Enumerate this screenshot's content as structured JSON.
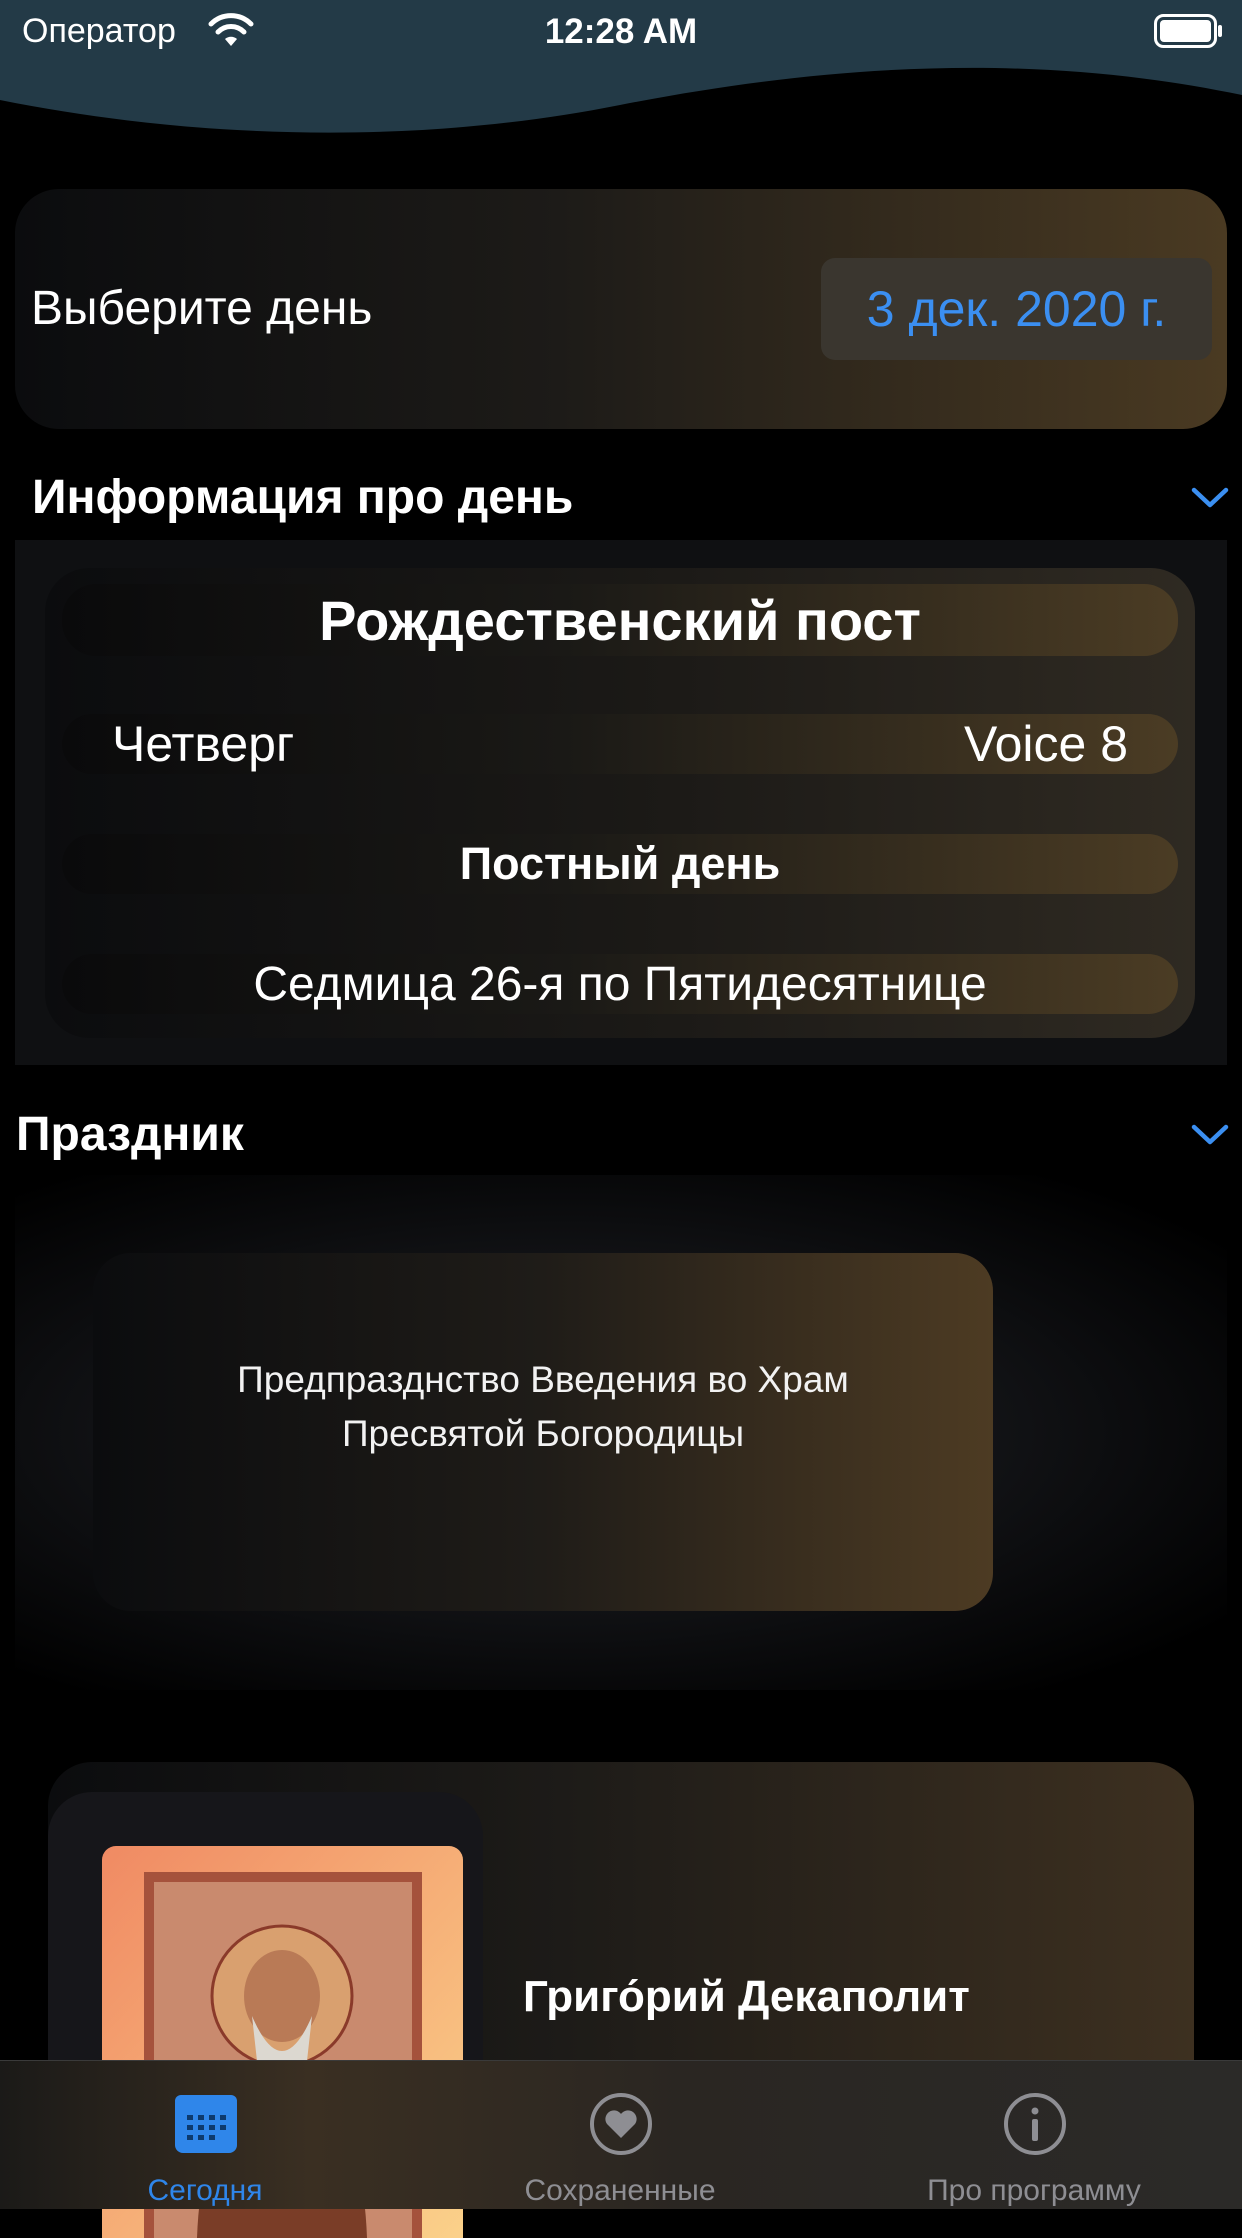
{
  "status_bar": {
    "carrier": "Оператор",
    "time": "12:28 AM"
  },
  "date_picker": {
    "label": "Выберите день",
    "value": "3 дек. 2020 г."
  },
  "day_info": {
    "title": "Информация про день",
    "fast_name": "Рождественский пост",
    "weekday": "Четверг",
    "voice": "Voice 8",
    "fasting": "Постный день",
    "week": "Седмица 26-я по Пятидесятнице"
  },
  "feast": {
    "title": "Праздник",
    "name": "Предпразднство Введения во Храм\nПресвятой Богородицы"
  },
  "saint": {
    "name": "Григо́рий Декаполит"
  },
  "tabs": [
    {
      "label": "Сегодня",
      "icon": "calendar-icon",
      "active": true
    },
    {
      "label": "Сохраненные",
      "icon": "heart-icon",
      "active": false
    },
    {
      "label": "Про программу",
      "icon": "info-icon",
      "active": false
    }
  ],
  "colors": {
    "accent": "#3b8ff1",
    "header": "#233a47",
    "inactive_tab": "#8e8e93"
  }
}
